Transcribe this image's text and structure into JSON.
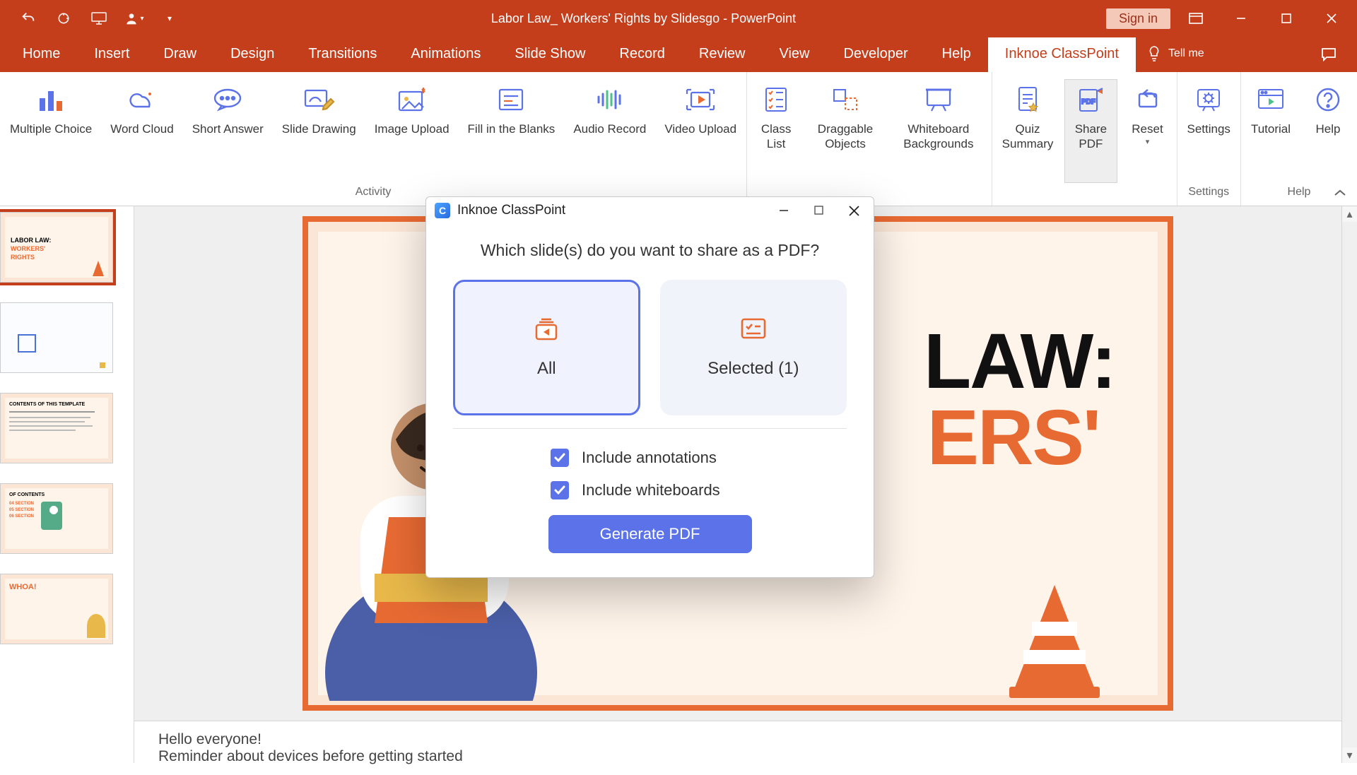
{
  "titlebar": {
    "title": "Labor Law_ Workers' Rights by Slidesgo  -  PowerPoint",
    "signin": "Sign in"
  },
  "tabs": [
    "Home",
    "Insert",
    "Draw",
    "Design",
    "Transitions",
    "Animations",
    "Slide Show",
    "Record",
    "Review",
    "View",
    "Developer",
    "Help",
    "Inknoe ClassPoint"
  ],
  "active_tab": "Inknoe ClassPoint",
  "tell_me": "Tell me",
  "ribbon": {
    "groups": [
      {
        "label": "Activity",
        "items": [
          {
            "label": "Multiple Choice",
            "icon": "bars-chart"
          },
          {
            "label": "Word Cloud",
            "icon": "cloud"
          },
          {
            "label": "Short Answer",
            "icon": "speech"
          },
          {
            "label": "Slide Drawing",
            "icon": "pencil-slide"
          },
          {
            "label": "Image Upload",
            "icon": "image-up"
          },
          {
            "label": "Fill in the Blanks",
            "icon": "form-lines"
          },
          {
            "label": "Audio Record",
            "icon": "audio-wave"
          },
          {
            "label": "Video Upload",
            "icon": "video-frame"
          }
        ]
      },
      {
        "label": "",
        "items": [
          {
            "label": "Class List",
            "icon": "list-stars"
          },
          {
            "label": "Draggable Objects",
            "icon": "shapes"
          },
          {
            "label": "Whiteboard Backgrounds",
            "icon": "board"
          }
        ]
      },
      {
        "label": "",
        "items": [
          {
            "label": "Quiz Summary",
            "icon": "doc-star"
          },
          {
            "label": "Share PDF",
            "icon": "pdf-share",
            "active": true
          },
          {
            "label": "Reset",
            "icon": "reset-arrow"
          }
        ]
      },
      {
        "label": "Settings",
        "items": [
          {
            "label": "Settings",
            "icon": "gear"
          }
        ]
      },
      {
        "label": "Help",
        "items": [
          {
            "label": "Tutorial",
            "icon": "play-window"
          },
          {
            "label": "Help",
            "icon": "help-circle"
          }
        ]
      }
    ]
  },
  "slide": {
    "title_line1": "LAW:",
    "title_line2": "ERS'",
    "thumb1_l1": "LABOR LAW:",
    "thumb1_l2": "WORKERS'",
    "thumb1_l3": "RIGHTS",
    "thumb3": "CONTENTS OF THIS TEMPLATE",
    "thumb4": "OF CONTENTS",
    "thumb5": "WHOA!"
  },
  "notes": {
    "line1": "Hello everyone!",
    "line2": "Reminder about devices before getting started"
  },
  "dialog": {
    "title": "Inknoe ClassPoint",
    "question": "Which slide(s) do you want to share as a PDF?",
    "opt_all": "All",
    "opt_selected": "Selected (1)",
    "chk_annotations": "Include annotations",
    "chk_whiteboards": "Include whiteboards",
    "generate": "Generate PDF"
  }
}
